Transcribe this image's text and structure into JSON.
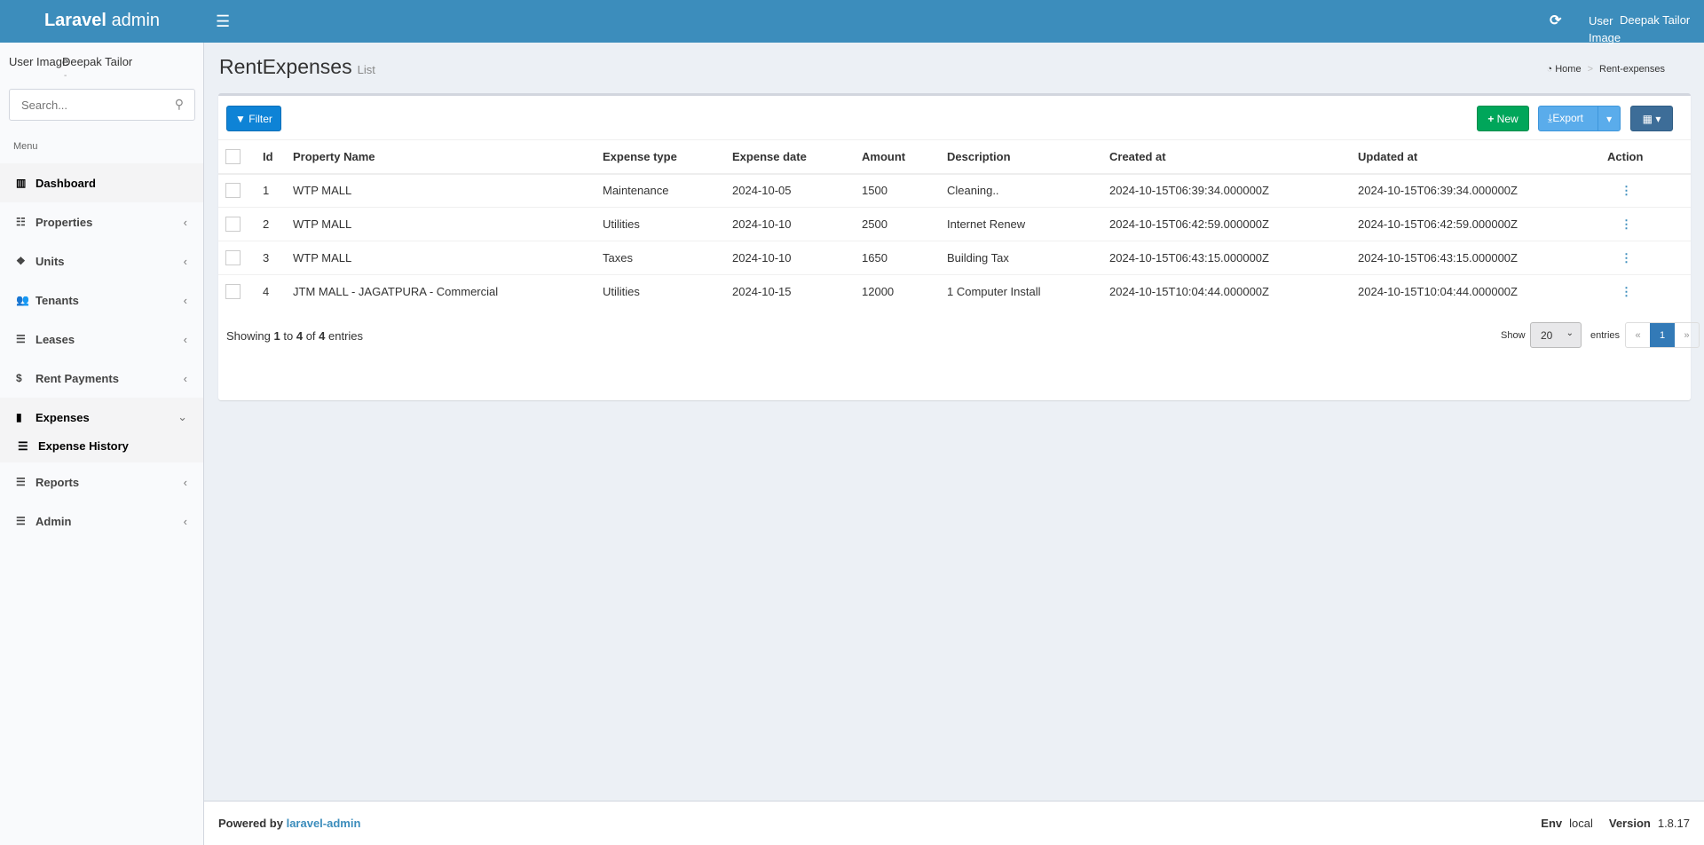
{
  "header": {
    "logo_bold": "Laravel",
    "logo_rest": "admin",
    "user_image_alt": "User Image",
    "user_name": "Deepak Tailor"
  },
  "sidebar": {
    "user_image_alt": "User Image",
    "user_name": "Deepak Tailor",
    "user_status": "-",
    "search_placeholder": "Search...",
    "menu_header": "Menu",
    "items": [
      {
        "label": "Dashboard"
      },
      {
        "label": "Properties"
      },
      {
        "label": "Units"
      },
      {
        "label": "Tenants"
      },
      {
        "label": "Leases"
      },
      {
        "label": "Rent Payments"
      },
      {
        "label": "Expenses"
      },
      {
        "label": "Reports"
      },
      {
        "label": "Admin"
      }
    ],
    "subitem": "Expense History"
  },
  "page": {
    "title": "RentExpenses",
    "subtitle": "List",
    "breadcrumb": [
      "Home",
      "Rent-expenses"
    ]
  },
  "toolbar": {
    "filter": "Filter",
    "new": "New",
    "export": "Export"
  },
  "table": {
    "headers": [
      "Id",
      "Property Name",
      "Expense type",
      "Expense date",
      "Amount",
      "Description",
      "Created at",
      "Updated at",
      "Action"
    ],
    "rows": [
      [
        "1",
        "WTP MALL",
        "Maintenance",
        "2024-10-05",
        "1500",
        "Cleaning..",
        "2024-10-15T06:39:34.000000Z",
        "2024-10-15T06:39:34.000000Z"
      ],
      [
        "2",
        "WTP MALL",
        "Utilities",
        "2024-10-10",
        "2500",
        "Internet Renew",
        "2024-10-15T06:42:59.000000Z",
        "2024-10-15T06:42:59.000000Z"
      ],
      [
        "3",
        "WTP MALL",
        "Taxes",
        "2024-10-10",
        "1650",
        "Building Tax",
        "2024-10-15T06:43:15.000000Z",
        "2024-10-15T06:43:15.000000Z"
      ],
      [
        "4",
        "JTM MALL - JAGATPURA - Commercial",
        "Utilities",
        "2024-10-15",
        "12000",
        "1 Computer Install",
        "2024-10-15T10:04:44.000000Z",
        "2024-10-15T10:04:44.000000Z"
      ]
    ]
  },
  "pagination": {
    "showing": "Showing",
    "from": "1",
    "to_word": "to",
    "to": "4",
    "of_word": "of",
    "total": "4",
    "entries_word": "entries",
    "show": "Show",
    "per_page": "20",
    "entries": "entries",
    "prev": "«",
    "current": "1",
    "next": "»"
  },
  "footer": {
    "powered": "Powered by",
    "link": "laravel-admin",
    "env_label": "Env",
    "env": "local",
    "version_label": "Version",
    "version": "1.8.17"
  }
}
